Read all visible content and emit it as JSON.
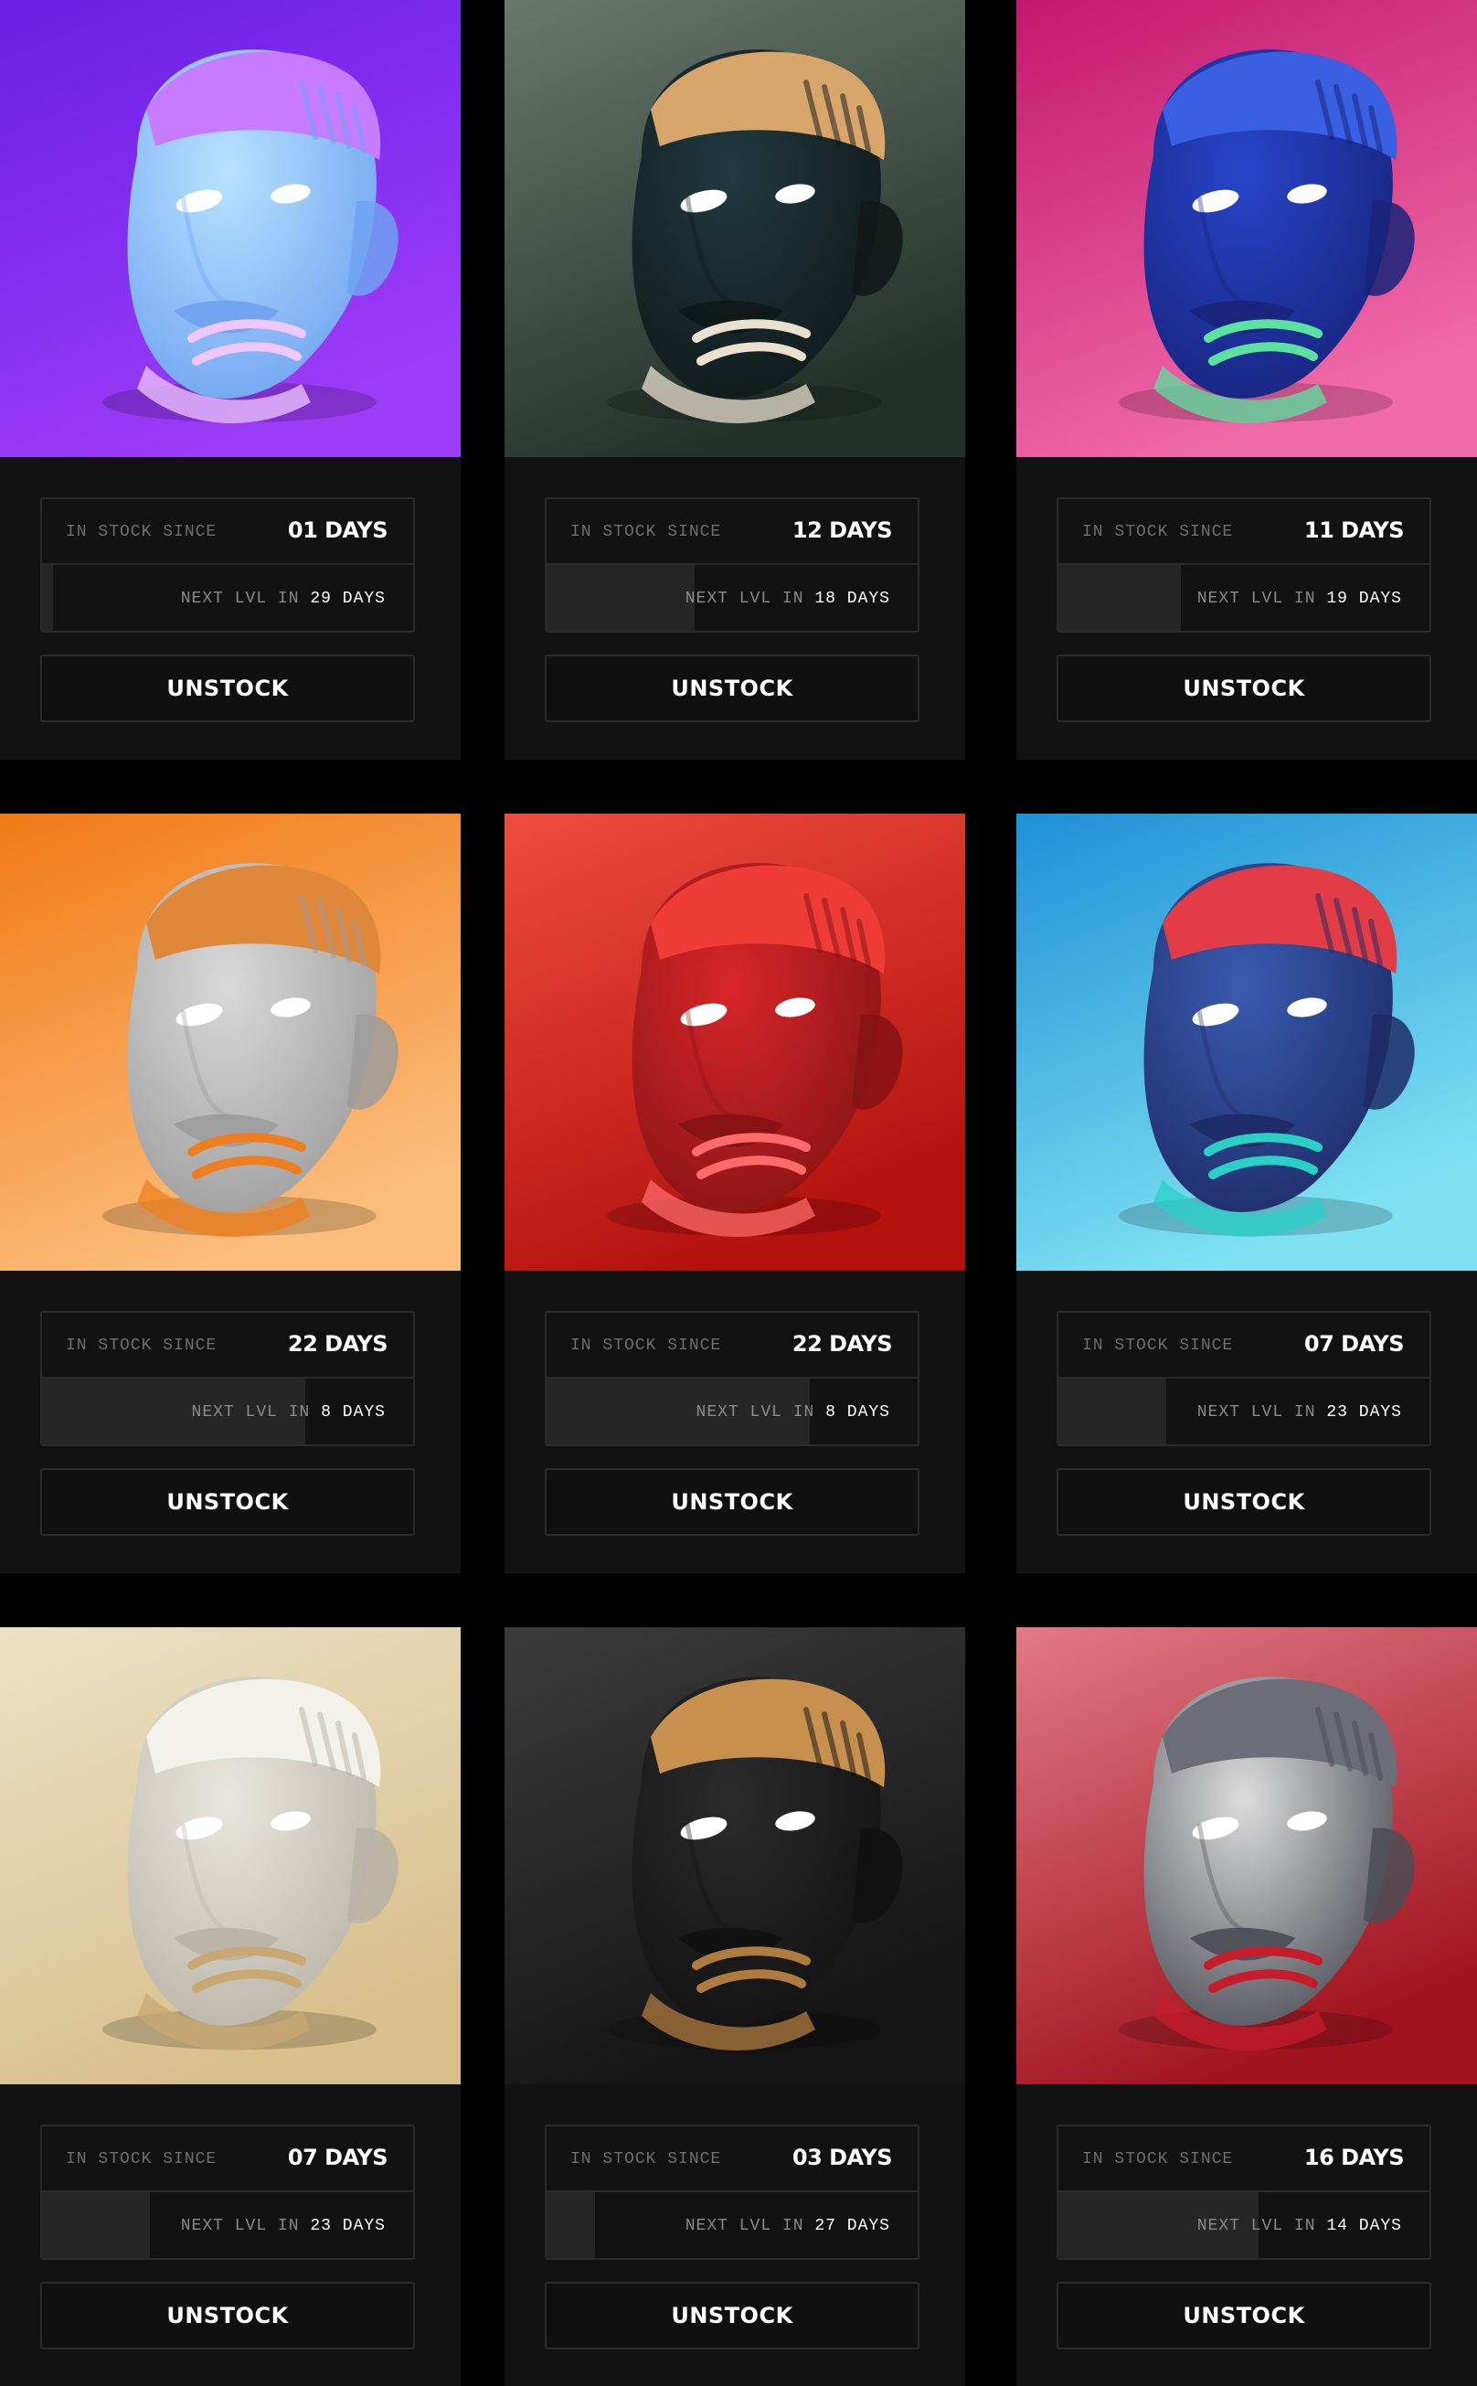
{
  "cards": [
    {
      "since_label": "IN STOCK SINCE",
      "days": "01 DAYS",
      "next_prefix": "NEXT LVL IN",
      "next_num": "29",
      "next_unit": "DAYS",
      "progress": 0.03,
      "button": "UNSTOCK",
      "art": {
        "bg_top": "#6a1ee6",
        "bg_bottom": "#9b3cf7",
        "head": "#b7e2ff",
        "head_shade": "#6fa2f0",
        "band": "#c77bff",
        "accent": "#f0c6ff"
      }
    },
    {
      "since_label": "IN STOCK SINCE",
      "days": "12 DAYS",
      "next_prefix": "NEXT LVL IN",
      "next_num": "18",
      "next_unit": "DAYS",
      "progress": 0.4,
      "button": "UNSTOCK",
      "art": {
        "bg_top": "#69796c",
        "bg_bottom": "#24302a",
        "head": "#203a40",
        "head_shade": "#101818",
        "band": "#d8a66b",
        "accent": "#e9e0d0"
      }
    },
    {
      "since_label": "IN STOCK SINCE",
      "days": "11 DAYS",
      "next_prefix": "NEXT LVL IN",
      "next_num": "19",
      "next_unit": "DAYS",
      "progress": 0.33,
      "button": "UNSTOCK",
      "art": {
        "bg_top": "#c2186e",
        "bg_bottom": "#f06aa8",
        "head": "#2645c9",
        "head_shade": "#18237a",
        "band": "#3a5fe0",
        "accent": "#5be2a0"
      }
    },
    {
      "since_label": "IN STOCK SINCE",
      "days": "22 DAYS",
      "next_prefix": "NEXT LVL IN",
      "next_num": "8",
      "next_unit": "DAYS",
      "progress": 0.71,
      "button": "UNSTOCK",
      "art": {
        "bg_top": "#f07a16",
        "bg_bottom": "#fbbd7c",
        "head": "#d9d9d9",
        "head_shade": "#9c9c9c",
        "band": "#e0883a",
        "accent": "#ef7f1e"
      }
    },
    {
      "since_label": "IN STOCK SINCE",
      "days": "22 DAYS",
      "next_prefix": "NEXT LVL IN",
      "next_num": "8",
      "next_unit": "DAYS",
      "progress": 0.71,
      "button": "UNSTOCK",
      "art": {
        "bg_top": "#ee4d3e",
        "bg_bottom": "#b3110e",
        "head": "#d8262a",
        "head_shade": "#851313",
        "band": "#ef3c36",
        "accent": "#ff6a6a"
      }
    },
    {
      "since_label": "IN STOCK SINCE",
      "days": "07 DAYS",
      "next_prefix": "NEXT LVL IN",
      "next_num": "23",
      "next_unit": "DAYS",
      "progress": 0.29,
      "button": "UNSTOCK",
      "art": {
        "bg_top": "#1e90d6",
        "bg_bottom": "#7fe1f2",
        "head": "#3a5bb0",
        "head_shade": "#1d2b66",
        "band": "#e23c46",
        "accent": "#2ad0c8"
      }
    },
    {
      "since_label": "IN STOCK SINCE",
      "days": "07 DAYS",
      "next_prefix": "NEXT LVL IN",
      "next_num": "23",
      "next_unit": "DAYS",
      "progress": 0.29,
      "button": "UNSTOCK",
      "art": {
        "bg_top": "#ece1c6",
        "bg_bottom": "#d8c08c",
        "head": "#e9e6df",
        "head_shade": "#b9b3a6",
        "band": "#f3f1ec",
        "accent": "#c9a874"
      }
    },
    {
      "since_label": "IN STOCK SINCE",
      "days": "03 DAYS",
      "next_prefix": "NEXT LVL IN",
      "next_num": "27",
      "next_unit": "DAYS",
      "progress": 0.13,
      "button": "UNSTOCK",
      "art": {
        "bg_top": "#3b3b3b",
        "bg_bottom": "#141414",
        "head": "#2b2b2b",
        "head_shade": "#111111",
        "band": "#c8904f",
        "accent": "#b07b3f"
      }
    },
    {
      "since_label": "IN STOCK SINCE",
      "days": "16 DAYS",
      "next_prefix": "NEXT LVL IN",
      "next_num": "14",
      "next_unit": "DAYS",
      "progress": 0.54,
      "button": "UNSTOCK",
      "art": {
        "bg_top": "#e07a85",
        "bg_bottom": "#a1141f",
        "head": "#dcdcdc",
        "head_shade": "#4a4d55",
        "band": "#6b6e76",
        "accent": "#c61c2c"
      }
    }
  ]
}
